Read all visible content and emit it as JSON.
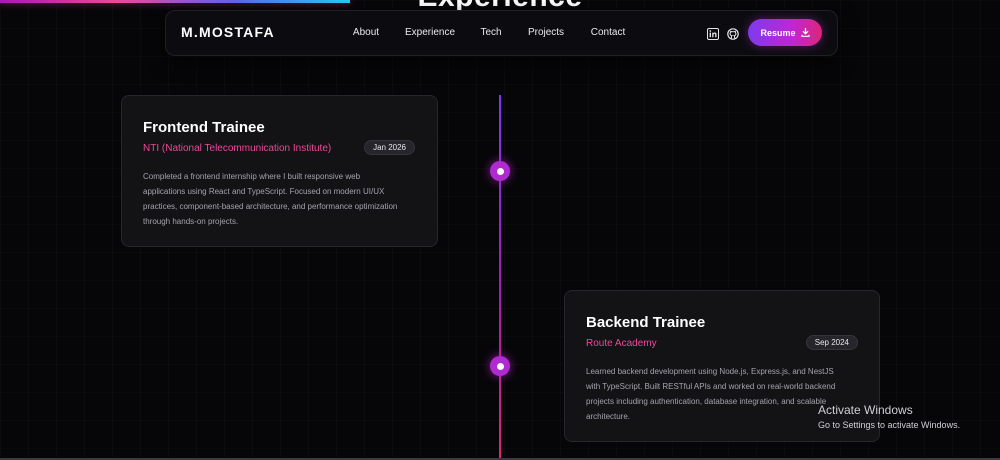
{
  "section": {
    "heading": "Experience"
  },
  "scroll_progress": 0.35,
  "nav": {
    "logo": "M.MOSTAFA",
    "links": [
      "About",
      "Experience",
      "Tech",
      "Projects",
      "Contact"
    ],
    "icons": [
      "linkedin-icon",
      "github-icon"
    ],
    "resume_label": "Resume",
    "resume_icon": "download-icon"
  },
  "experience": [
    {
      "title": "Frontend Trainee",
      "org": "NTI (National Telecommunication Institute)",
      "date": "Jan 2026",
      "description": "Completed a frontend internship where I built responsive web applications using React and TypeScript. Focused on modern UI/UX practices, component-based architecture, and performance optimization through hands-on projects."
    },
    {
      "title": "Backend Trainee",
      "org": "Route Academy",
      "date": "Sep 2024",
      "description": "Learned backend development using Node.js, Express.js, and NestJS with TypeScript. Built RESTful APIs and worked on real-world backend projects including authentication, database integration, and scalable architecture."
    }
  ],
  "os_overlay": {
    "title": "Activate Windows",
    "subtitle": "Go to Settings to activate Windows."
  },
  "colors": {
    "accent": "#ec4899",
    "accent_purple": "#b02ad1",
    "background": "#060608",
    "card": "#131316"
  }
}
